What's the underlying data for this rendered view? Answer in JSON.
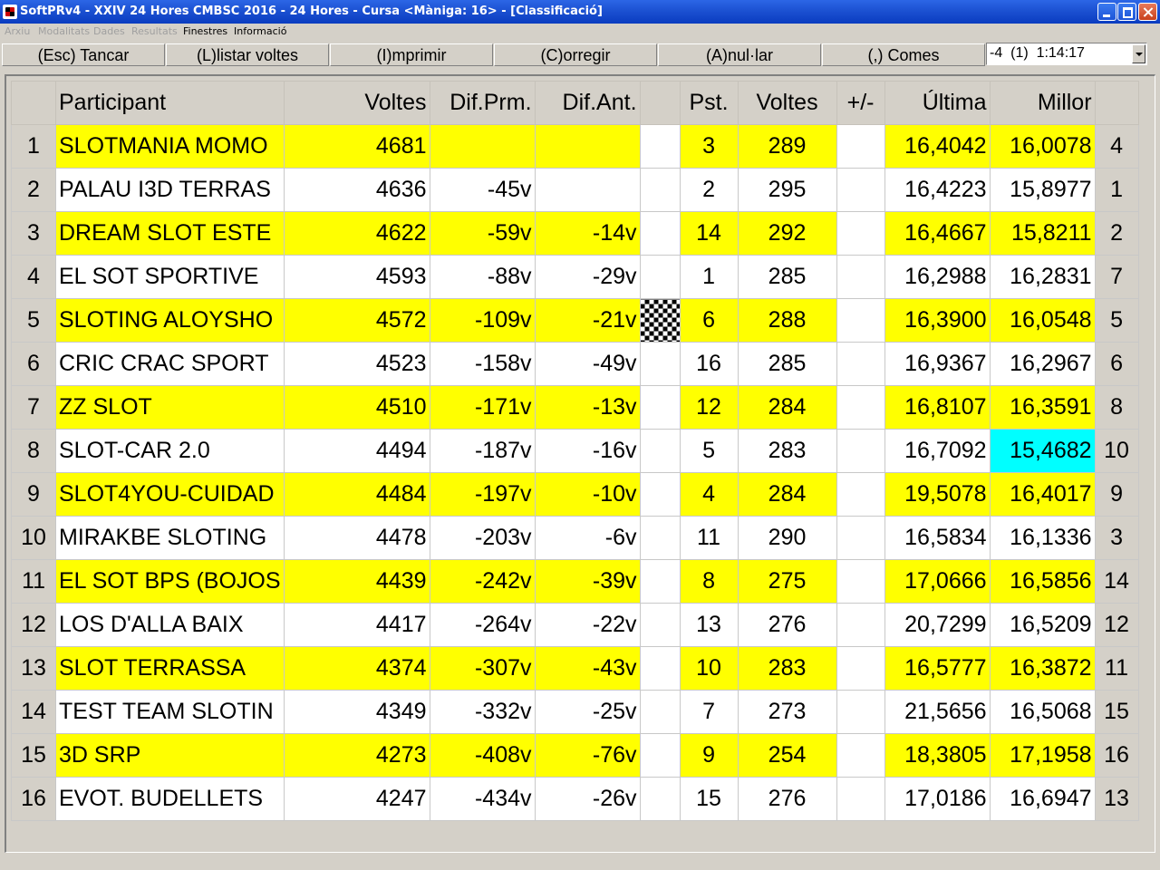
{
  "window": {
    "title": "SoftPRv4 - XXIV 24 Hores CMBSC 2016 - 24 Hores - Cursa <Màniga: 16> - [Classificació]"
  },
  "menu": {
    "items": [
      {
        "label": "Arxiu",
        "enabled": false
      },
      {
        "label": "Modalitats",
        "enabled": false
      },
      {
        "label": "Dades",
        "enabled": false
      },
      {
        "label": "Resultats",
        "enabled": false
      },
      {
        "label": "Finestres",
        "enabled": true
      },
      {
        "label": "Informació",
        "enabled": true
      }
    ]
  },
  "toolbar": {
    "buttons": [
      "(Esc) Tancar",
      "(L)listar voltes",
      "(I)mprimir",
      "(C)orregir",
      "(A)nul·lar",
      "(,) Comes"
    ],
    "combo_value": "-4  (1)  1:14:17"
  },
  "table": {
    "headers": [
      "",
      "Participant",
      "Voltes",
      "Dif.Prm.",
      "Dif.Ant.",
      "",
      "Pst.",
      "Voltes",
      "+/-",
      "Última",
      "Millor",
      ""
    ],
    "rows": [
      {
        "pos": "1",
        "name": "SLOTMANIA MOMO",
        "laps": "4681",
        "dif_prm": "",
        "dif_ant": "",
        "flag": false,
        "pst": "3",
        "voltes": "289",
        "pm": "",
        "ultima": "16,4042",
        "millor": "16,0078",
        "rank": "4",
        "hl": false
      },
      {
        "pos": "2",
        "name": "PALAU I3D TERRAS",
        "laps": "4636",
        "dif_prm": "-45v",
        "dif_ant": "",
        "flag": false,
        "pst": "2",
        "voltes": "295",
        "pm": "",
        "ultima": "16,4223",
        "millor": "15,8977",
        "rank": "1",
        "hl": false
      },
      {
        "pos": "3",
        "name": "DREAM SLOT ESTE",
        "laps": "4622",
        "dif_prm": "-59v",
        "dif_ant": "-14v",
        "flag": false,
        "pst": "14",
        "voltes": "292",
        "pm": "",
        "ultima": "16,4667",
        "millor": "15,8211",
        "rank": "2",
        "hl": false
      },
      {
        "pos": "4",
        "name": "EL SOT SPORTIVE",
        "laps": "4593",
        "dif_prm": "-88v",
        "dif_ant": "-29v",
        "flag": false,
        "pst": "1",
        "voltes": "285",
        "pm": "",
        "ultima": "16,2988",
        "millor": "16,2831",
        "rank": "7",
        "hl": false
      },
      {
        "pos": "5",
        "name": "SLOTING ALOYSHO",
        "laps": "4572",
        "dif_prm": "-109v",
        "dif_ant": "-21v",
        "flag": true,
        "pst": "6",
        "voltes": "288",
        "pm": "",
        "ultima": "16,3900",
        "millor": "16,0548",
        "rank": "5",
        "hl": false
      },
      {
        "pos": "6",
        "name": "CRIC CRAC SPORT",
        "laps": "4523",
        "dif_prm": "-158v",
        "dif_ant": "-49v",
        "flag": false,
        "pst": "16",
        "voltes": "285",
        "pm": "",
        "ultima": "16,9367",
        "millor": "16,2967",
        "rank": "6",
        "hl": false
      },
      {
        "pos": "7",
        "name": "ZZ SLOT",
        "laps": "4510",
        "dif_prm": "-171v",
        "dif_ant": "-13v",
        "flag": false,
        "pst": "12",
        "voltes": "284",
        "pm": "",
        "ultima": "16,8107",
        "millor": "16,3591",
        "rank": "8",
        "hl": false
      },
      {
        "pos": "8",
        "name": "SLOT-CAR 2.0",
        "laps": "4494",
        "dif_prm": "-187v",
        "dif_ant": "-16v",
        "flag": false,
        "pst": "5",
        "voltes": "283",
        "pm": "",
        "ultima": "16,7092",
        "millor": "15,4682",
        "rank": "10",
        "hl": true
      },
      {
        "pos": "9",
        "name": "SLOT4YOU-CUIDAD",
        "laps": "4484",
        "dif_prm": "-197v",
        "dif_ant": "-10v",
        "flag": false,
        "pst": "4",
        "voltes": "284",
        "pm": "",
        "ultima": "19,5078",
        "millor": "16,4017",
        "rank": "9",
        "hl": false
      },
      {
        "pos": "10",
        "name": "MIRAKBE SLOTING",
        "laps": "4478",
        "dif_prm": "-203v",
        "dif_ant": "-6v",
        "flag": false,
        "pst": "11",
        "voltes": "290",
        "pm": "",
        "ultima": "16,5834",
        "millor": "16,1336",
        "rank": "3",
        "hl": false
      },
      {
        "pos": "11",
        "name": "EL SOT BPS (BOJOS",
        "laps": "4439",
        "dif_prm": "-242v",
        "dif_ant": "-39v",
        "flag": false,
        "pst": "8",
        "voltes": "275",
        "pm": "",
        "ultima": "17,0666",
        "millor": "16,5856",
        "rank": "14",
        "hl": false
      },
      {
        "pos": "12",
        "name": "LOS D'ALLA BAIX",
        "laps": "4417",
        "dif_prm": "-264v",
        "dif_ant": "-22v",
        "flag": false,
        "pst": "13",
        "voltes": "276",
        "pm": "",
        "ultima": "20,7299",
        "millor": "16,5209",
        "rank": "12",
        "hl": false
      },
      {
        "pos": "13",
        "name": "SLOT TERRASSA",
        "laps": "4374",
        "dif_prm": "-307v",
        "dif_ant": "-43v",
        "flag": false,
        "pst": "10",
        "voltes": "283",
        "pm": "",
        "ultima": "16,5777",
        "millor": "16,3872",
        "rank": "11",
        "hl": false
      },
      {
        "pos": "14",
        "name": "TEST TEAM SLOTIN",
        "laps": "4349",
        "dif_prm": "-332v",
        "dif_ant": "-25v",
        "flag": false,
        "pst": "7",
        "voltes": "273",
        "pm": "",
        "ultima": "21,5656",
        "millor": "16,5068",
        "rank": "15",
        "hl": false
      },
      {
        "pos": "15",
        "name": "3D SRP",
        "laps": "4273",
        "dif_prm": "-408v",
        "dif_ant": "-76v",
        "flag": false,
        "pst": "9",
        "voltes": "254",
        "pm": "",
        "ultima": "18,3805",
        "millor": "17,1958",
        "rank": "16",
        "hl": false
      },
      {
        "pos": "16",
        "name": "EVOT. BUDELLETS",
        "laps": "4247",
        "dif_prm": "-434v",
        "dif_ant": "-26v",
        "flag": false,
        "pst": "15",
        "voltes": "276",
        "pm": "",
        "ultima": "17,0186",
        "millor": "16,6947",
        "rank": "13",
        "hl": false
      }
    ]
  },
  "colors": {
    "row_highlight": "#ffff00",
    "best_lap": "#00ffff",
    "titlebar": "#0a3cc0"
  }
}
